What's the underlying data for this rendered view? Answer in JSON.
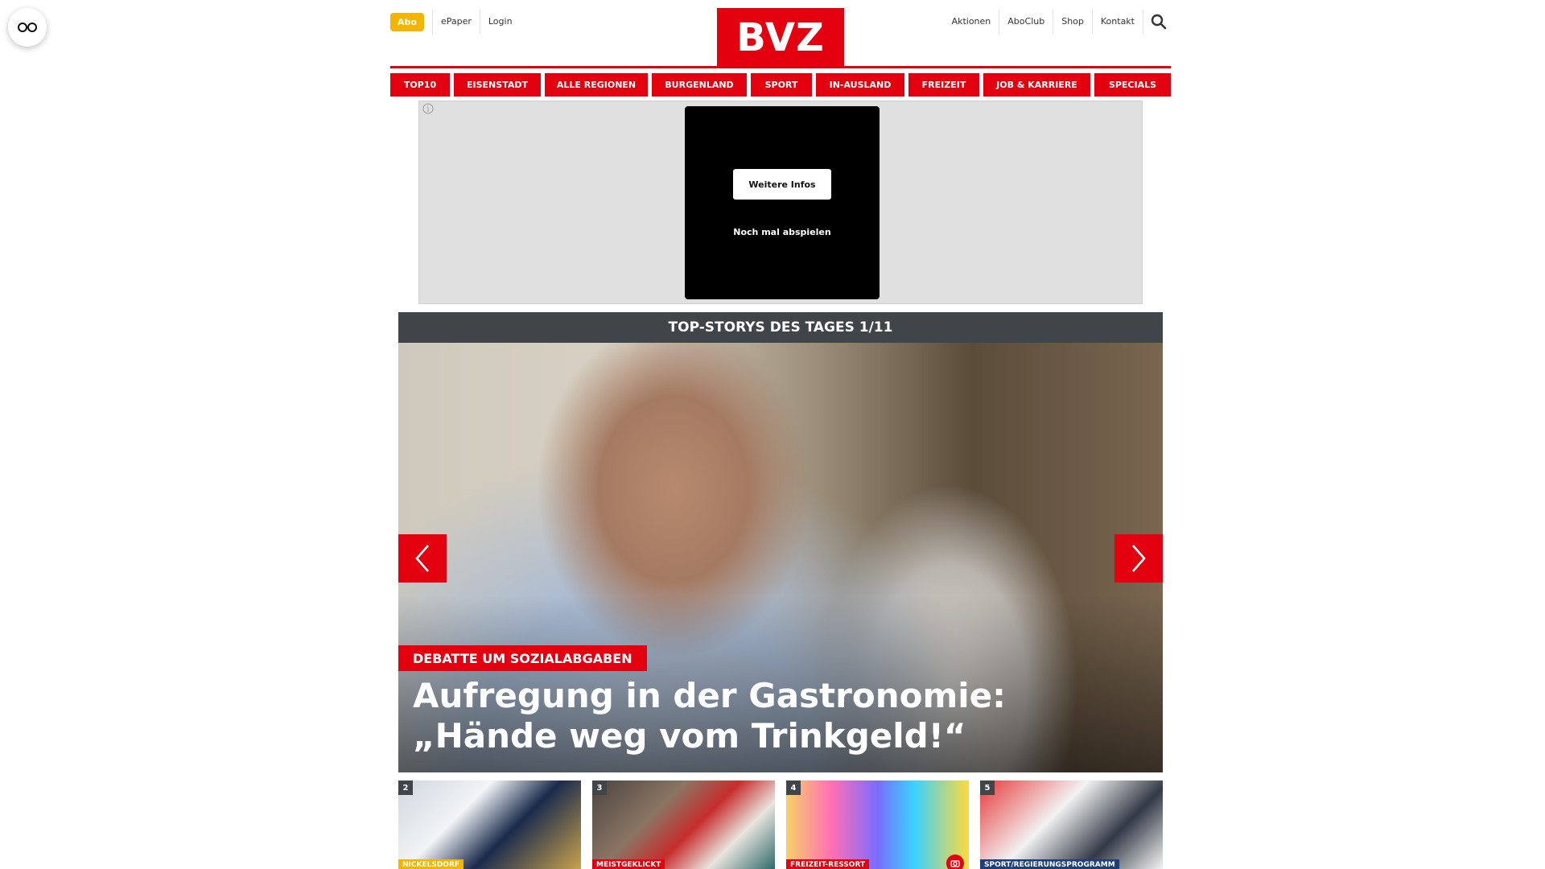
{
  "header": {
    "abo_label": "Abo",
    "epaper_label": "ePaper",
    "login_label": "Login",
    "logo_text": "BVZ",
    "aktionen_label": "Aktionen",
    "aboclub_label": "AboClub",
    "shop_label": "Shop",
    "kontakt_label": "Kontakt"
  },
  "nav": {
    "items": [
      "TOP10",
      "EISENSTADT",
      "ALLE REGIONEN",
      "BURGENLAND",
      "SPORT",
      "IN-AUSLAND",
      "FREIZEIT",
      "JOB & KARRIERE",
      "SPECIALS"
    ]
  },
  "ad": {
    "more_label": "Weitere Infos",
    "replay_label": "Noch mal abspielen"
  },
  "stories": {
    "heading": "TOP-STORYS DES TAGES 1/11",
    "hero": {
      "kicker": "DEBATTE UM SOZIALABGABEN",
      "title": "Aufregung in der Gastronomie: „Hände weg vom Trinkgeld!“"
    },
    "thumbs": [
      {
        "num": "2",
        "tag": "NICKELSDORF",
        "tag_color": "#f5b400"
      },
      {
        "num": "3",
        "tag": "MEISTGEKLICKT",
        "tag_color": "#e3000f"
      },
      {
        "num": "4",
        "tag": "FREIZEIT-RESSORT",
        "tag_color": "#e3000f"
      },
      {
        "num": "5",
        "tag": "SPORT/REGIERUNGSPROGRAMM",
        "tag_color": "#1d3e7a"
      }
    ]
  },
  "colors": {
    "brand_red": "#e3000f",
    "abo_yellow": "#f5b400",
    "stories_bar": "#3f4549"
  },
  "icons": {
    "reader": "glasses-icon",
    "search": "search-icon",
    "prev": "chevron-left-icon",
    "next": "chevron-right-icon",
    "ad_info": "info-icon",
    "gallery": "camera-icon"
  }
}
